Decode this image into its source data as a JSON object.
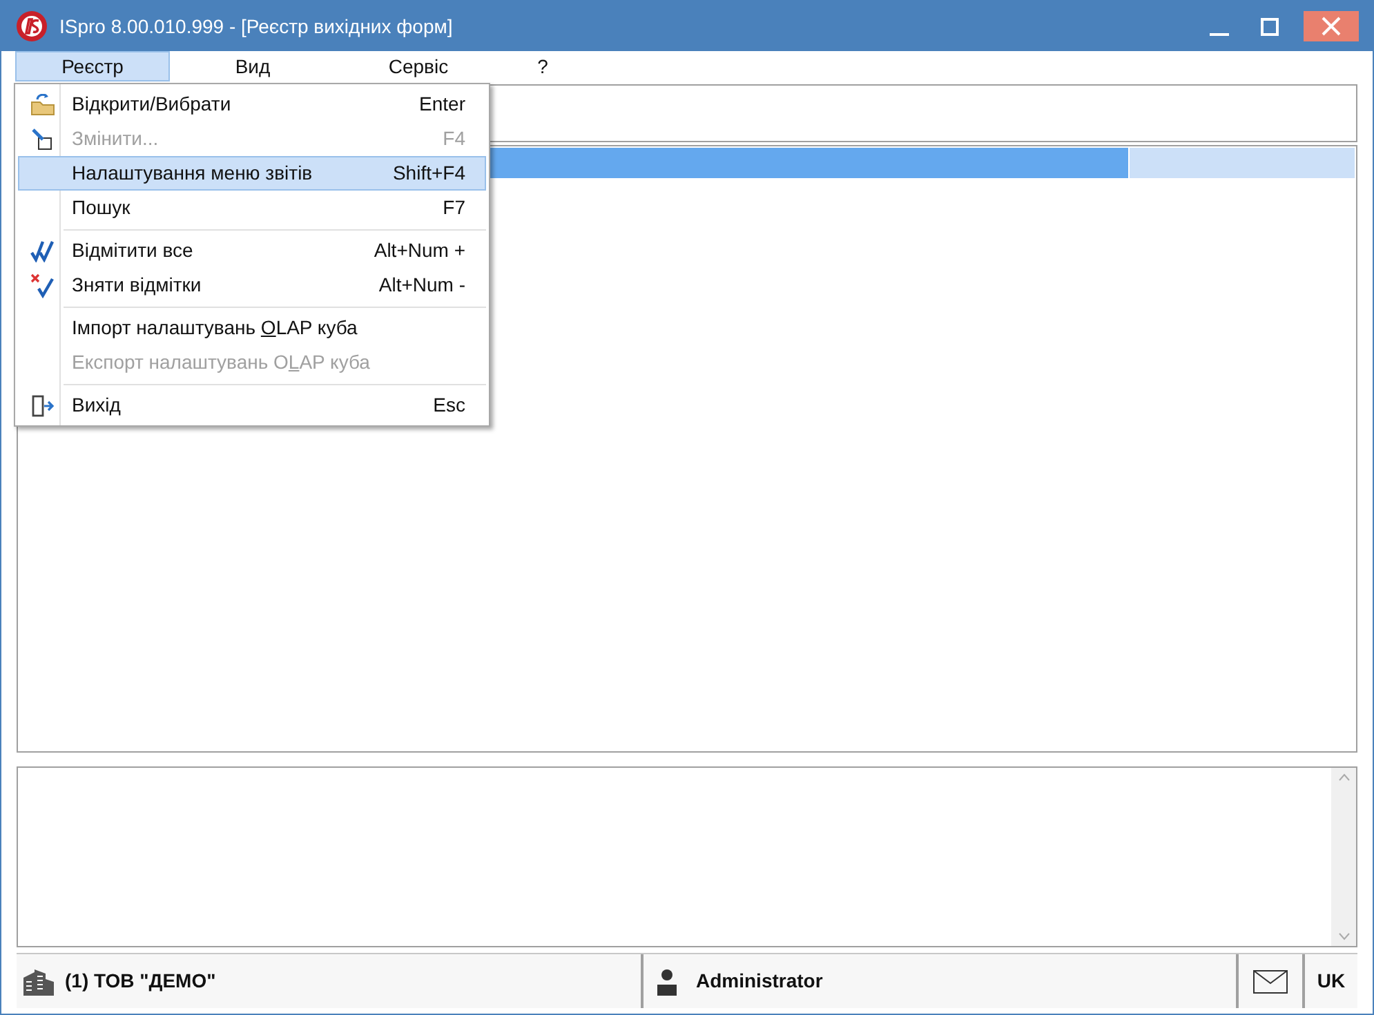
{
  "window": {
    "title": "ISpro 8.00.010.999 - [Реєстр вихідних форм]"
  },
  "menubar": [
    {
      "label": "Реєстр",
      "selected": true
    },
    {
      "label": "Вид",
      "selected": false
    },
    {
      "label": "Сервіс",
      "selected": false
    },
    {
      "label": "?",
      "selected": false
    }
  ],
  "menu": [
    {
      "kind": "item",
      "label_parts": [
        {
          "text": "Відкрити/Вибрати",
          "underlined": false
        }
      ],
      "shortcut": "Enter",
      "disabled": false,
      "selected": false
    },
    {
      "kind": "item",
      "label_parts": [
        {
          "text": "Змінити...",
          "underlined": false
        }
      ],
      "shortcut": "F4",
      "disabled": true,
      "selected": false
    },
    {
      "kind": "item",
      "label_parts": [
        {
          "text": "Налаштування меню звітів",
          "underlined": false
        }
      ],
      "shortcut": "Shift+F4",
      "disabled": false,
      "selected": true
    },
    {
      "kind": "item",
      "label_parts": [
        {
          "text": "Пошук",
          "underlined": false
        }
      ],
      "shortcut": "F7",
      "disabled": false,
      "selected": false
    },
    {
      "kind": "separator"
    },
    {
      "kind": "item",
      "label_parts": [
        {
          "text": "Відмітити все",
          "underlined": false
        }
      ],
      "shortcut": "Alt+Num +",
      "disabled": false,
      "selected": false
    },
    {
      "kind": "item",
      "label_parts": [
        {
          "text": "Зняти відмітки",
          "underlined": false
        }
      ],
      "shortcut": "Alt+Num -",
      "disabled": false,
      "selected": false
    },
    {
      "kind": "separator"
    },
    {
      "kind": "item",
      "label_parts": [
        {
          "text": "Імпорт налаштувань ",
          "underlined": false
        },
        {
          "text": "O",
          "underlined": true
        },
        {
          "text": "LAP куба",
          "underlined": false
        }
      ],
      "disabled": false,
      "selected": false
    },
    {
      "kind": "item",
      "label_parts": [
        {
          "text": "Експорт налаштувань O",
          "underlined": false
        },
        {
          "text": "L",
          "underlined": true
        },
        {
          "text": "AP куба",
          "underlined": false
        }
      ],
      "disabled": true,
      "selected": false
    },
    {
      "kind": "separator"
    },
    {
      "kind": "item",
      "label_parts": [
        {
          "text": "Вихід",
          "underlined": false
        }
      ],
      "shortcut": "Esc",
      "disabled": false,
      "selected": false
    }
  ],
  "status_bar": {
    "organization": "(1) ТОВ \"ДЕМО\"",
    "user": "Administrator",
    "language": "UK"
  }
}
